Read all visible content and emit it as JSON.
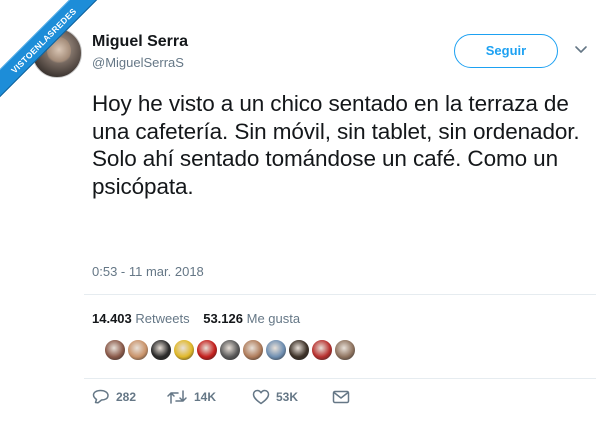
{
  "watermark": {
    "text": "VISTOENLASREDES"
  },
  "author": {
    "name": "Miguel Serra",
    "handle": "@MiguelSerraS"
  },
  "follow_button": {
    "label": "Seguir"
  },
  "tweet": {
    "text": "Hoy he visto a un chico sentado en la terraza de una cafetería. Sin móvil, sin tablet, sin ordenador. Solo ahí sentado tomándose un café. Como un psicópata.",
    "timestamp": "0:53 - 11 mar. 2018"
  },
  "stats": {
    "retweets_count": "14.403",
    "retweets_label": "Retweets",
    "likes_count": "53.126",
    "likes_label": "Me gusta"
  },
  "likers": [
    {
      "color": "#8a5a4a"
    },
    {
      "color": "#c9936a"
    },
    {
      "color": "#2b2b2b"
    },
    {
      "color": "#e0b82a"
    },
    {
      "color": "#c4201d"
    },
    {
      "color": "#5a5a5a"
    },
    {
      "color": "#b07d5c"
    },
    {
      "color": "#6f8fb2"
    },
    {
      "color": "#3d3228"
    },
    {
      "color": "#b8312f"
    },
    {
      "color": "#8f7460"
    }
  ],
  "actions": {
    "replies": "282",
    "retweets": "14K",
    "likes": "53K"
  },
  "colors": {
    "accent": "#1da1f2",
    "muted": "#657786",
    "text": "#14171a",
    "ribbon": "#1d8dd8"
  }
}
